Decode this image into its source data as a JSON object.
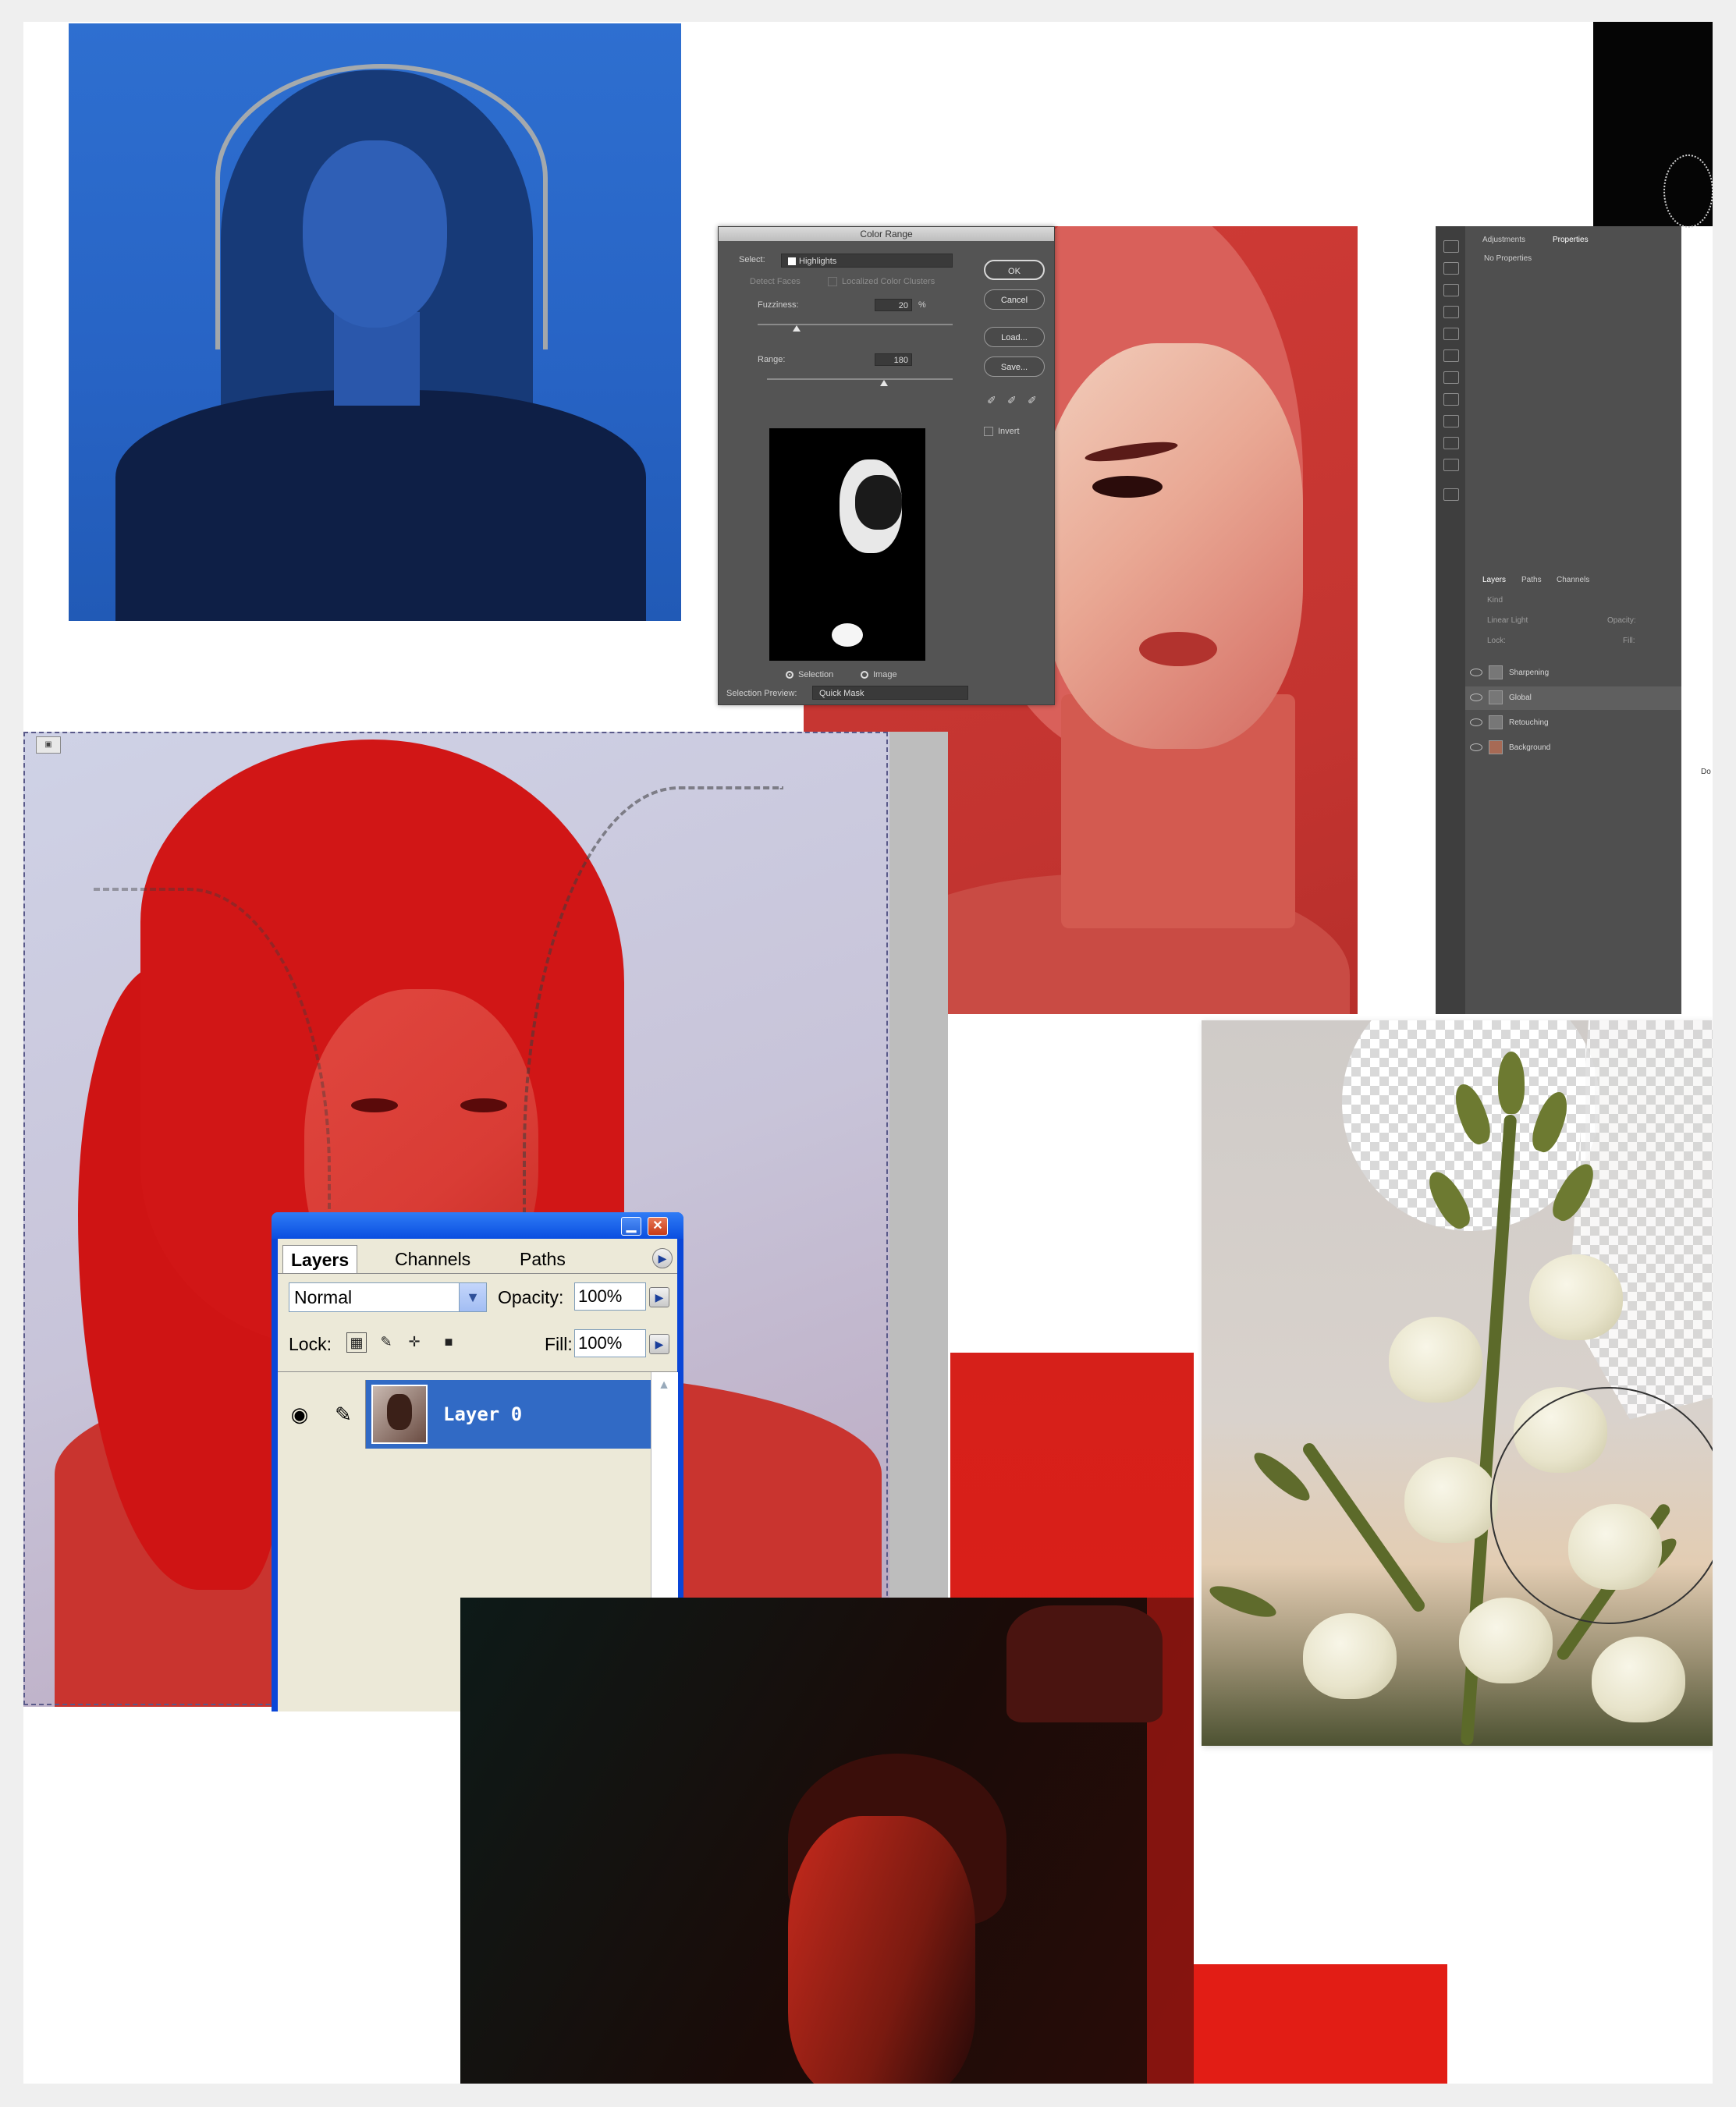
{
  "color_range": {
    "title": "Color Range",
    "select_label": "Select:",
    "select_value": "Highlights",
    "detect_faces": "Detect Faces",
    "localized": "Localized Color Clusters",
    "fuzziness_label": "Fuzziness:",
    "fuzziness_value": "20",
    "fuzziness_unit": "%",
    "range_label": "Range:",
    "range_value": "180",
    "radio_selection": "Selection",
    "radio_image": "Image",
    "preview_label": "Selection Preview:",
    "preview_value": "Quick Mask",
    "buttons": {
      "ok": "OK",
      "cancel": "Cancel",
      "load": "Load...",
      "save": "Save..."
    },
    "invert": "Invert"
  },
  "ps_panel": {
    "top_tabs": [
      "Adjustments",
      "Properties"
    ],
    "no_properties": "No Properties",
    "layer_tabs": [
      "Layers",
      "Paths",
      "Channels"
    ],
    "kind": "Kind",
    "blend": "Linear Light",
    "opacity": "Opacity:",
    "lock": "Lock:",
    "fill": "Fill:",
    "layers": [
      "Sharpening",
      "Global",
      "Retouching",
      "Background"
    ],
    "doc_tab": "Do"
  },
  "xp_layers": {
    "tabs": [
      "Layers",
      "Channels",
      "Paths"
    ],
    "blend_mode": "Normal",
    "opacity_label": "Opacity:",
    "opacity_value": "100%",
    "lock_label": "Lock:",
    "fill_label": "Fill:",
    "fill_value": "100%",
    "layer_name": "Layer 0"
  },
  "colors": {
    "photoshop_dark": "#545454",
    "xp_blue": "#0a46d8",
    "selected_layer": "#316ac5",
    "accent_red": "#e01c16",
    "accent_blue": "#2763c4"
  }
}
